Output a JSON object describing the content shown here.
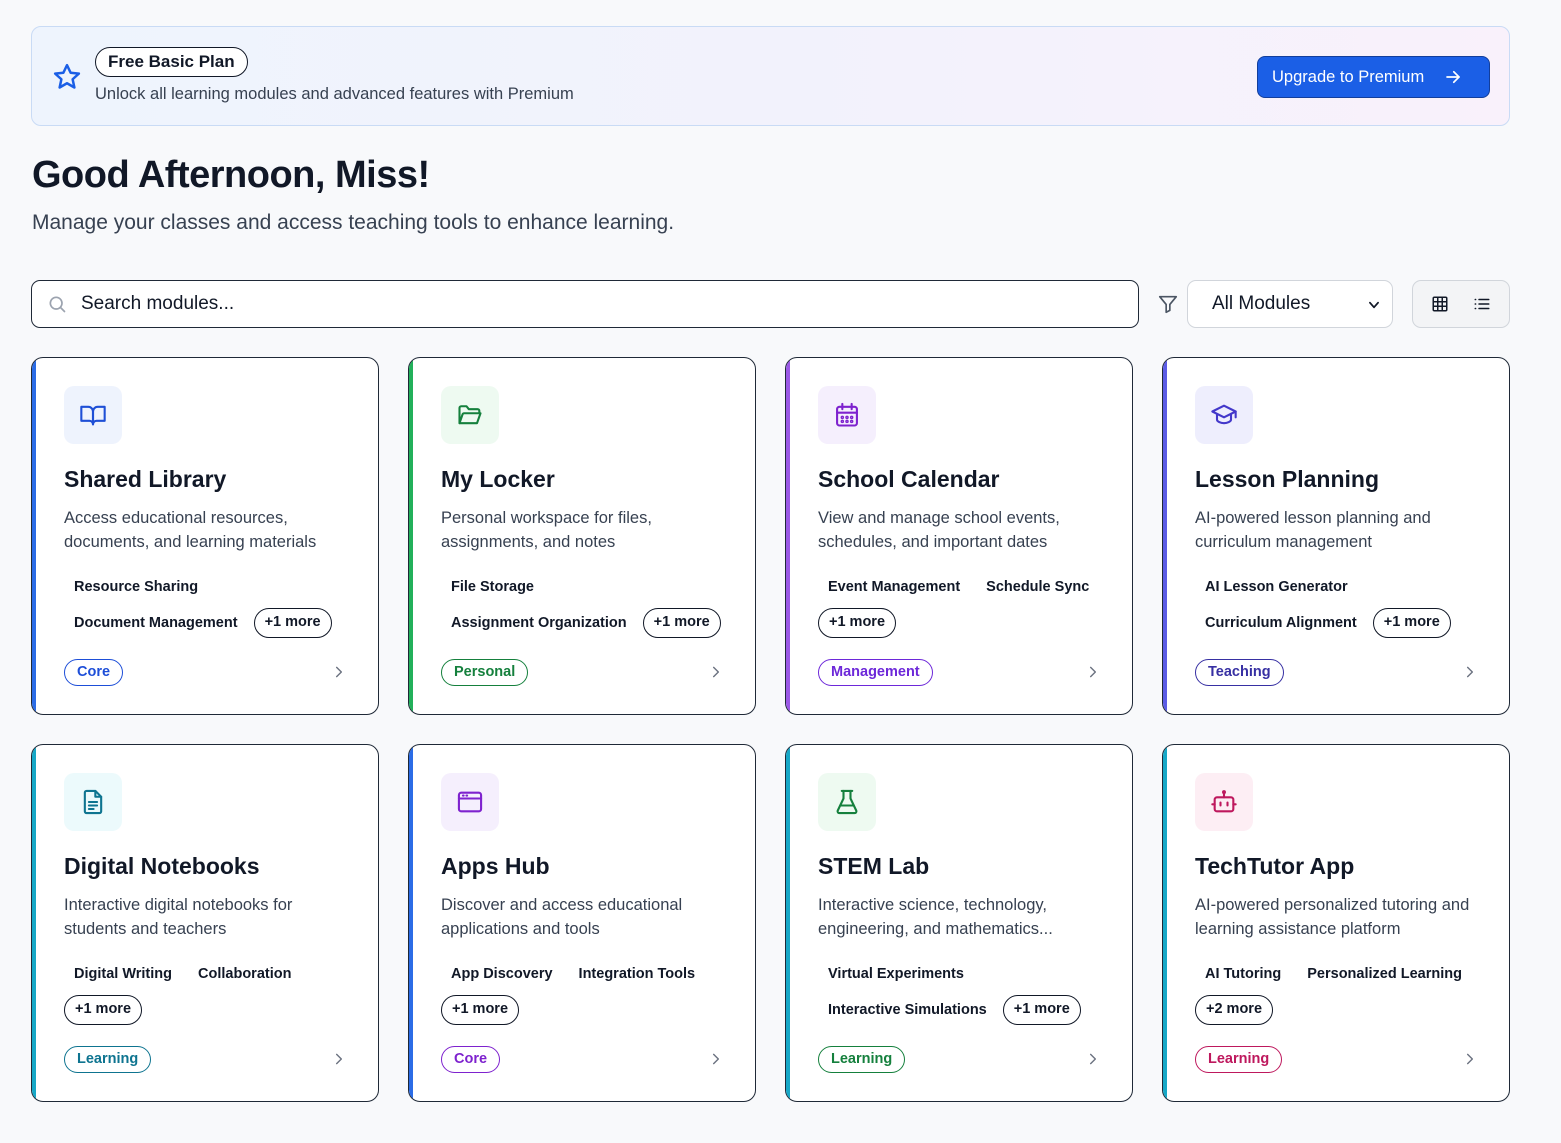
{
  "banner": {
    "icon": "star-icon",
    "plan_label": "Free Basic Plan",
    "message": "Unlock all learning modules and advanced features with Premium",
    "upgrade_label": "Upgrade to Premium",
    "upgrade_icon": "arrow-right-icon"
  },
  "greeting": {
    "title": "Good Afternoon, Miss!",
    "subtitle": "Manage your classes and access teaching tools to enhance learning."
  },
  "toolbar": {
    "search_placeholder": "Search modules...",
    "filter_icon": "filter-icon",
    "module_filter": "All Modules",
    "views": [
      "grid-view-icon",
      "list-view-icon"
    ]
  },
  "colors": {
    "blue": "#2b6ce6",
    "green": "#22b05a",
    "purple": "#9b59e6",
    "indigo": "#5b5ce6",
    "cyan": "#17a8c7",
    "primary_button": "#1b5fe6"
  },
  "cards": [
    {
      "title": "Shared Library",
      "description": "Access educational resources, documents, and learning materials",
      "icon": "book-open-icon",
      "tags": [
        "Resource Sharing",
        "Document Management"
      ],
      "more": "+1 more",
      "category": "Core",
      "accent": "#2b6ce6",
      "icon_color": "#1e4fd6",
      "icon_bg": "#eef3fd",
      "category_color": "#1d4ed8"
    },
    {
      "title": "My Locker",
      "description": "Personal workspace for files, assignments, and notes",
      "icon": "folder-open-icon",
      "tags": [
        "File Storage",
        "Assignment Organization"
      ],
      "more": "+1 more",
      "category": "Personal",
      "accent": "#22b05a",
      "icon_color": "#15803d",
      "icon_bg": "#eefaf1",
      "category_color": "#15803d"
    },
    {
      "title": "School Calendar",
      "description": "View and manage school events, schedules, and important dates",
      "icon": "calendar-icon",
      "tags": [
        "Event Management",
        "Schedule Sync"
      ],
      "more": "+1 more",
      "category": "Management",
      "accent": "#9b59e6",
      "icon_color": "#7e22ce",
      "icon_bg": "#f5effd",
      "category_color": "#6d28d9"
    },
    {
      "title": "Lesson Planning",
      "description": "AI-powered lesson planning and curriculum management",
      "icon": "graduation-cap-icon",
      "tags": [
        "AI Lesson Generator",
        "Curriculum Alignment"
      ],
      "more": "+1 more",
      "category": "Teaching",
      "accent": "#5b5ce6",
      "icon_color": "#4338ca",
      "icon_bg": "#eeeefd",
      "category_color": "#3730a3"
    },
    {
      "title": "Digital Notebooks",
      "description": "Interactive digital notebooks for students and teachers",
      "icon": "file-text-icon",
      "tags": [
        "Digital Writing",
        "Collaboration"
      ],
      "more": "+1 more",
      "category": "Learning",
      "accent": "#17a8c7",
      "icon_color": "#0e7490",
      "icon_bg": "#ecfafc",
      "category_color": "#0e7490"
    },
    {
      "title": "Apps Hub",
      "description": "Discover and access educational applications and tools",
      "icon": "app-window-icon",
      "tags": [
        "App Discovery",
        "Integration Tools"
      ],
      "more": "+1 more",
      "category": "Core",
      "accent": "#2b6ce6",
      "icon_color": "#7e22ce",
      "icon_bg": "#f5effd",
      "category_color": "#7e22ce"
    },
    {
      "title": "STEM Lab",
      "description": "Interactive science, technology, engineering, and mathematics...",
      "icon": "flask-icon",
      "tags": [
        "Virtual Experiments",
        "Interactive Simulations"
      ],
      "more": "+1 more",
      "category": "Learning",
      "accent": "#17a8c7",
      "icon_color": "#15803d",
      "icon_bg": "#eefaf1",
      "category_color": "#15803d"
    },
    {
      "title": "TechTutor App",
      "description": "AI-powered personalized tutoring and learning assistance platform",
      "icon": "robot-icon",
      "tags": [
        "AI Tutoring",
        "Personalized Learning"
      ],
      "more": "+2 more",
      "category": "Learning",
      "accent": "#17a8c7",
      "icon_color": "#be185d",
      "icon_bg": "#fdeef4",
      "category_color": "#be185d"
    }
  ]
}
